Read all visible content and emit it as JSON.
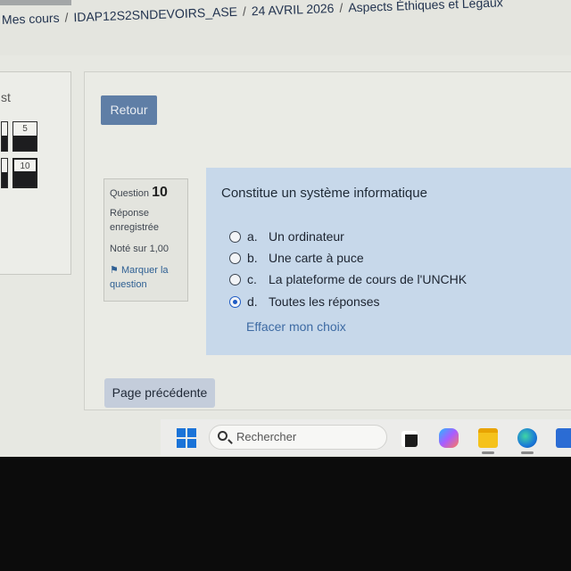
{
  "breadcrumb": {
    "items": [
      "Mes cours",
      "IDAP12S2SNDEVOIRS_ASE",
      "24 AVRIL 2026",
      "Aspects Éthiques et Légaux"
    ],
    "separator": "/"
  },
  "quiz_nav": {
    "title": "st",
    "buttons": [
      "5",
      "10"
    ]
  },
  "back_button": "Retour",
  "question_info": {
    "question_label": "Question",
    "question_number": "10",
    "state_line1": "Réponse",
    "state_line2": "enregistrée",
    "grade": "Noté sur 1,00",
    "flag_line1": "Marquer la",
    "flag_line2": "question"
  },
  "question": {
    "text": "Constitue un système informatique",
    "answers": [
      {
        "letter": "a.",
        "label": "Un ordinateur",
        "selected": false
      },
      {
        "letter": "b.",
        "label": "Une carte à puce",
        "selected": false
      },
      {
        "letter": "c.",
        "label": "La plateforme de cours de l'UNCHK",
        "selected": false
      },
      {
        "letter": "d.",
        "label": "Toutes les réponses",
        "selected": true
      }
    ],
    "clear_choice": "Effacer mon choix"
  },
  "prev_page": "Page précédente",
  "taskbar": {
    "search_placeholder": "Rechercher",
    "icons": [
      "start-icon",
      "search-icon",
      "task-view-icon",
      "copilot-icon",
      "file-explorer-icon",
      "edge-icon",
      "store-icon"
    ]
  },
  "colors": {
    "accent": "#5f7ea6",
    "question_bg": "#c7d8ea",
    "selected_radio": "#1f5bc4",
    "link": "#3d6aa3"
  }
}
